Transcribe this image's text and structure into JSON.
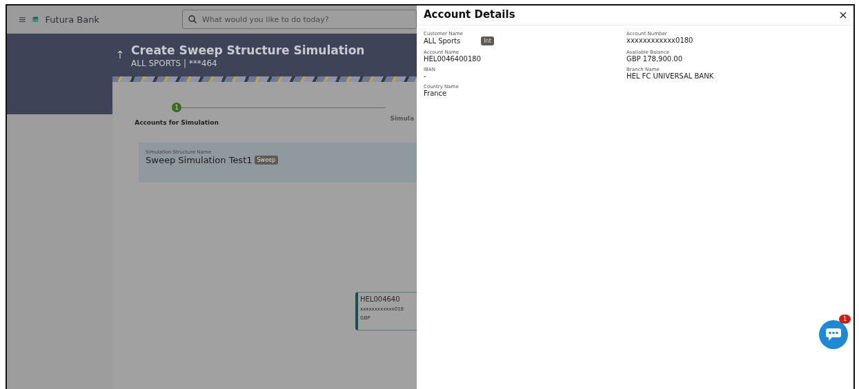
{
  "header": {
    "brand": "Futura Bank",
    "search": {
      "placeholder": "What would you like to do today?"
    }
  },
  "page": {
    "title": "Create Sweep Structure Simulation",
    "subtitle": "ALL SPORTS | ***464"
  },
  "stepper": [
    {
      "number": "1",
      "label": "Accounts for Simulation",
      "selected": true
    },
    {
      "label": "Simula",
      "selected": false
    }
  ],
  "structure": {
    "label": "Simulation Structure Name",
    "value": "Sweep Simulation Test1",
    "tag": "Sweep"
  },
  "account_card": {
    "lines": [
      "HEL004640",
      "xxxxxxxxxxxx018",
      "GBP"
    ]
  },
  "drawer": {
    "title": "Account Details",
    "fields": [
      {
        "label": "Customer Name",
        "value": "ALL Sports",
        "tag": "Int"
      },
      {
        "label": "Account Number",
        "value": "xxxxxxxxxxxx0180"
      },
      {
        "label": "Account Name",
        "value": "HEL0046400180"
      },
      {
        "label": "Available Balance",
        "value": "GBP 178,900.00"
      },
      {
        "label": "IBAN",
        "value": "-"
      },
      {
        "label": "Branch Name",
        "value": "HEL FC UNIVERSAL BANK"
      },
      {
        "label": "Country Name",
        "value": "France"
      }
    ]
  },
  "chat": {
    "badge": "1"
  }
}
